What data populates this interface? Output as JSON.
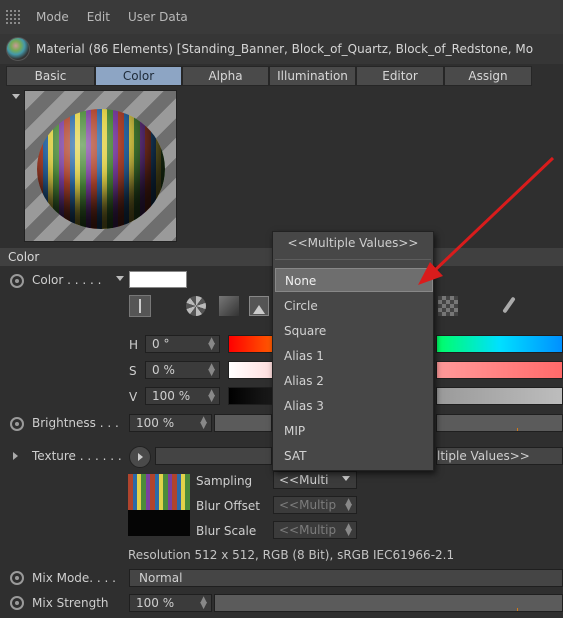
{
  "menubar": {
    "items": [
      "Mode",
      "Edit",
      "User Data"
    ]
  },
  "title": "Material (86 Elements) [Standing_Banner, Block_of_Quartz, Block_of_Redstone, Mo",
  "tabs": [
    {
      "label": "Basic",
      "active": false
    },
    {
      "label": "Color",
      "active": true
    },
    {
      "label": "Alpha",
      "active": false
    },
    {
      "label": "Illumination",
      "active": false
    },
    {
      "label": "Editor",
      "active": false
    },
    {
      "label": "Assign",
      "active": false
    }
  ],
  "section": {
    "title": "Color"
  },
  "color_row": {
    "label": "Color . . . . ."
  },
  "hsv": {
    "h": {
      "letter": "H",
      "value": "0 °"
    },
    "s": {
      "letter": "S",
      "value": "0 %"
    },
    "v": {
      "letter": "V",
      "value": "100 %"
    }
  },
  "brightness": {
    "label": "Brightness . . .",
    "value": "100 %"
  },
  "texture": {
    "label": "Texture . . . . . .",
    "value_tail": "ltiple Values>>",
    "sampling_label": "Sampling",
    "sampling_value": "<<Multi",
    "blur_offset_label": "Blur Offset",
    "blur_offset_value": "<<Multip",
    "blur_scale_label": "Blur Scale",
    "blur_scale_value": "<<Multip",
    "resolution": "Resolution 512 x 512, RGB (8 Bit), sRGB IEC61966-2.1"
  },
  "mix_mode": {
    "label": "Mix Mode. . . .",
    "value": "Normal"
  },
  "mix_strength": {
    "label": "Mix Strength",
    "value": "100 %"
  },
  "dropdown": {
    "header": "<<Multiple Values>>",
    "items": [
      "None",
      "Circle",
      "Square",
      "Alias 1",
      "Alias 2",
      "Alias 3",
      "MIP",
      "SAT"
    ],
    "selected": "None"
  },
  "colors": {
    "accent_tab": "#8da5c4",
    "annotation_arrow": "#d91c1c",
    "value_tick": "#d07a1a"
  }
}
